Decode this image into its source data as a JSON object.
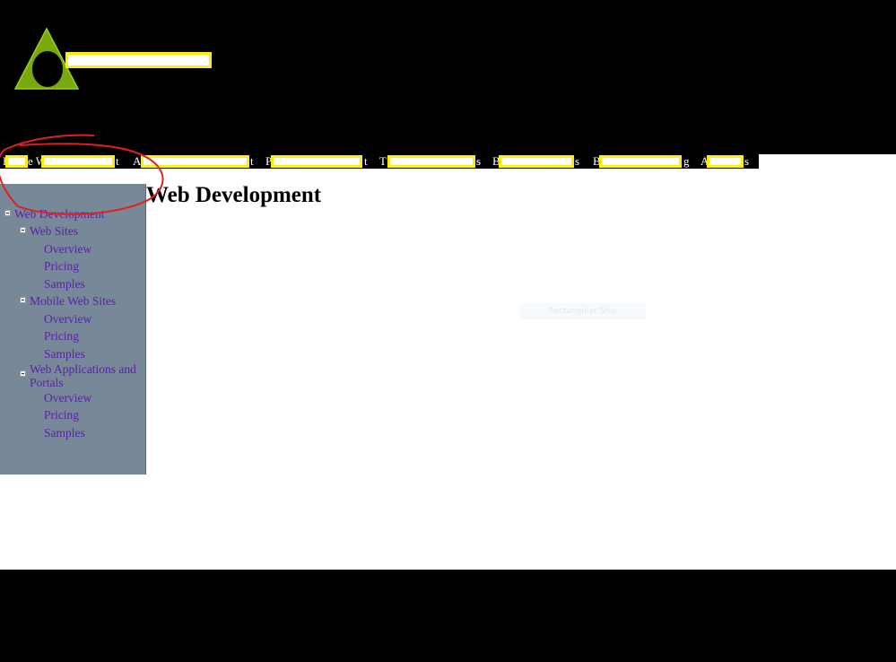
{
  "header": {
    "logo_color": "#7aa80f"
  },
  "nav": {
    "items": [
      {
        "pre": "H",
        "mid": "e W",
        "suffix": "t"
      },
      {
        "pre": "A",
        "suffix": "t"
      },
      {
        "pre": "P",
        "suffix": "t"
      },
      {
        "pre": "T",
        "suffix": "s"
      },
      {
        "pre": "B",
        "suffix": "s"
      },
      {
        "pre": "B",
        "suffix": "g"
      },
      {
        "pre": "A",
        "suffix": "s"
      }
    ]
  },
  "page": {
    "title": "Web Development"
  },
  "sidebar": {
    "tree": [
      {
        "label": "Web Development"
      },
      {
        "label": "Web Sites"
      },
      {
        "label": "Overview"
      },
      {
        "label": "Pricing"
      },
      {
        "label": "Samples"
      },
      {
        "label": "Mobile Web Sites"
      },
      {
        "label": "Overview"
      },
      {
        "label": "Pricing"
      },
      {
        "label": "Samples"
      },
      {
        "label": "Web Applications and Portals"
      },
      {
        "label": "Overview"
      },
      {
        "label": "Pricing"
      },
      {
        "label": "Samples"
      }
    ]
  },
  "overlay": {
    "snip_label": "Rectangular Snip"
  }
}
